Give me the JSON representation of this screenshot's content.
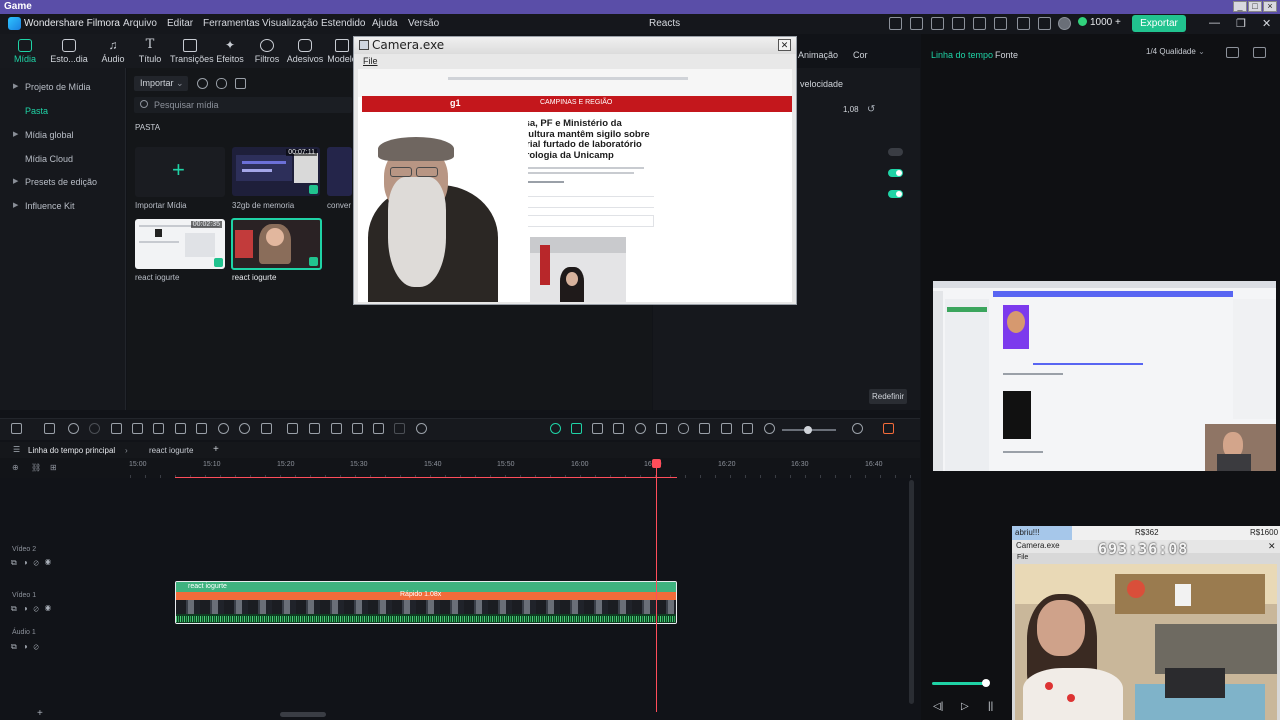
{
  "window": {
    "title": "Game"
  },
  "menubar": {
    "app_name": "Wondershare Filmora",
    "items": [
      "Arquivo",
      "Editar",
      "Ferramentas",
      "Visualização",
      "Estendido",
      "Ajuda",
      "Versão"
    ],
    "project_name": "Reacts",
    "credits": "1000 +",
    "export_label": "Exportar"
  },
  "toolbar": {
    "tools": [
      "Mídia",
      "Esto...dia",
      "Áudio",
      "Título",
      "Transições",
      "Efeitos",
      "Filtros",
      "Adesivos",
      "Modelo"
    ]
  },
  "sidebar": {
    "items": [
      {
        "label": "Projeto de Mídia",
        "expandable": true,
        "selected": false
      },
      {
        "label": "Pasta",
        "expandable": false,
        "selected": true
      },
      {
        "label": "Mídia global",
        "expandable": true,
        "selected": false
      },
      {
        "label": "Mídia Cloud",
        "expandable": false,
        "selected": false
      },
      {
        "label": "Presets de edição",
        "expandable": true,
        "selected": false
      },
      {
        "label": "Influence Kit",
        "expandable": true,
        "selected": false
      }
    ]
  },
  "media": {
    "import_label": "Importar",
    "search_placeholder": "Pesquisar mídia",
    "folder_label": "PASTA",
    "items": [
      {
        "label": "Importar Mídia",
        "duration": ""
      },
      {
        "label": "32gb de memoria",
        "duration": "00:07:11"
      },
      {
        "label": "conver",
        "duration": ""
      },
      {
        "label": "react iogurte",
        "duration": "00:02:35"
      },
      {
        "label": "react iogurte",
        "duration": ""
      }
    ]
  },
  "camera_window": {
    "title": "Camera.exe",
    "menu": "File",
    "article": {
      "section": "CAMPINAS E REGIÃO",
      "logo": "g1",
      "headline": "Anvisa, PF e Ministério da Agricultura mantêm sigilo sobre material furtado de laboratório de virologia da Unicamp"
    }
  },
  "properties": {
    "tabs": [
      "Animação",
      "Cor"
    ],
    "speed_label": "velocidade",
    "speed_value": "1,08",
    "reset_label": "Redefinir"
  },
  "player": {
    "tabs": [
      "Linha do tempo",
      "Fonte"
    ],
    "quality": "1/4 Qualidade",
    "volume_fraction": 0.9
  },
  "camera_overlay": {
    "tab1": "abriu!!!",
    "amount1": "R$362",
    "amount2": "R$1600",
    "title": "Camera.exe",
    "timer": "693:36:08",
    "menu": "File"
  },
  "timeline": {
    "main_tab": "Linha do tempo principal",
    "sequence_tab": "react iogurte",
    "ticks": [
      "15:00",
      "15:10",
      "15:20",
      "15:30",
      "15:40",
      "15:50",
      "16:00",
      "16:10",
      "16:20",
      "16:30",
      "16:40"
    ],
    "tracks": [
      "Vídeo 2",
      "Vídeo 1",
      "Áudio 1"
    ],
    "clip": {
      "name": "react iogurte",
      "speed_label": "Rápido 1.08x"
    }
  },
  "colors": {
    "accent": "#1fd3a6",
    "export": "#21c38f",
    "playhead": "#ff4d5a",
    "title_bar": "#5a4ea8"
  }
}
